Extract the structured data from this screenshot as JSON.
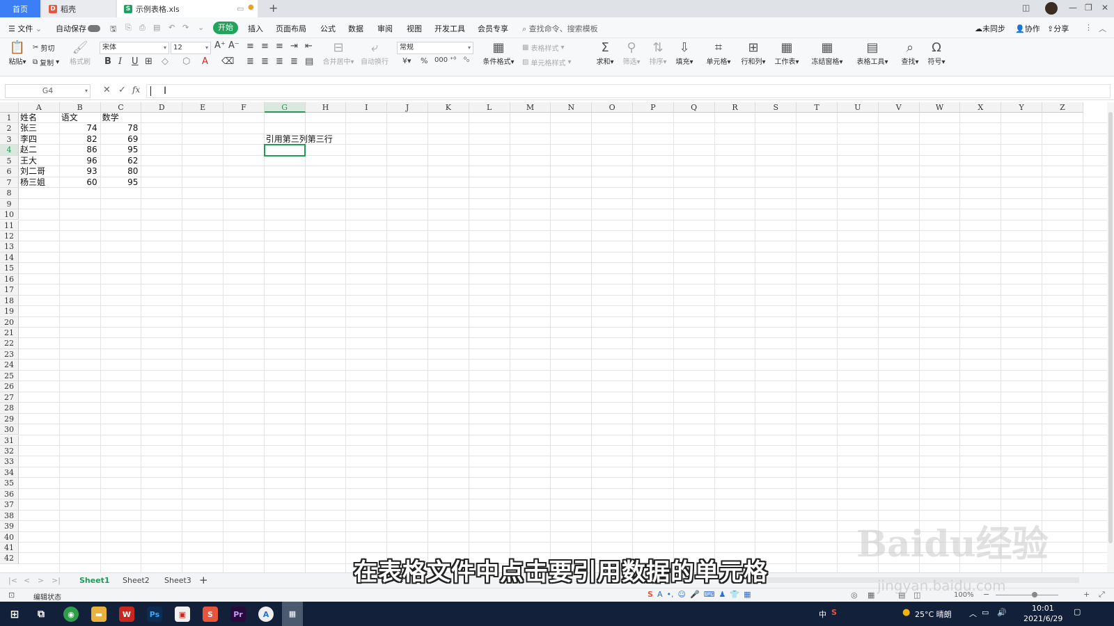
{
  "tabs": {
    "home": "首页",
    "daoke": "稻壳",
    "file": "示例表格.xls"
  },
  "menu": {
    "file": "文件",
    "autosave": "自动保存",
    "start": "开始",
    "insert": "插入",
    "layout": "页面布局",
    "formula": "公式",
    "data": "数据",
    "review": "审阅",
    "view": "视图",
    "dev": "开发工具",
    "member": "会员专享",
    "search": "查找命令、搜索模板",
    "unsynced": "未同步",
    "collab": "协作",
    "share": "分享"
  },
  "ribbon": {
    "paste": "粘贴",
    "cut": "剪切",
    "copy": "复制",
    "format_painter": "格式刷",
    "font": "宋体",
    "size": "12",
    "merge": "合并居中",
    "wrap": "自动换行",
    "number_format": "常规",
    "cond_format": "条件格式",
    "table_style": "表格样式",
    "cell_style": "单元格样式",
    "sum": "求和",
    "filter": "筛选",
    "sort": "排序",
    "fill": "填充",
    "cell": "单元格",
    "rowcol": "行和列",
    "worksheet": "工作表",
    "freeze": "冻结窗格",
    "table_tools": "表格工具",
    "find": "查找",
    "symbol": "符号"
  },
  "formula_bar": {
    "name_box": "G4",
    "fx": "fx",
    "value": ""
  },
  "columns": [
    "A",
    "B",
    "C",
    "D",
    "E",
    "F",
    "G",
    "H",
    "I",
    "J",
    "K",
    "L",
    "M",
    "N",
    "O",
    "P",
    "Q",
    "R",
    "S",
    "T",
    "U",
    "V",
    "W",
    "X",
    "Y",
    "Z"
  ],
  "table": {
    "headers": [
      "姓名",
      "语文",
      "数学"
    ],
    "rows": [
      [
        "张三",
        "74",
        "78"
      ],
      [
        "李四",
        "82",
        "69"
      ],
      [
        "赵二",
        "86",
        "95"
      ],
      [
        "王大",
        "96",
        "62"
      ],
      [
        "刘二哥",
        "93",
        "80"
      ],
      [
        "杨三姐",
        "60",
        "95"
      ]
    ]
  },
  "g3_text": "引用第三列第三行",
  "sheets": [
    "Sheet1",
    "Sheet2",
    "Sheet3"
  ],
  "status": {
    "mode": "编辑状态",
    "zoom": "100%"
  },
  "caption": "在表格文件中点击要引用数据的单元格",
  "watermark": {
    "main": "Baidu经验",
    "url": "jingyan.baidu.com"
  },
  "taskbar": {
    "ime": "中",
    "weather": "25°C 晴朗",
    "time": "10:01",
    "date": "2021/6/29"
  },
  "colors": {
    "accent": "#22a35a",
    "home_tab": "#3c7ef5",
    "selection": "#1e9b55",
    "taskbar": "#13203a"
  }
}
